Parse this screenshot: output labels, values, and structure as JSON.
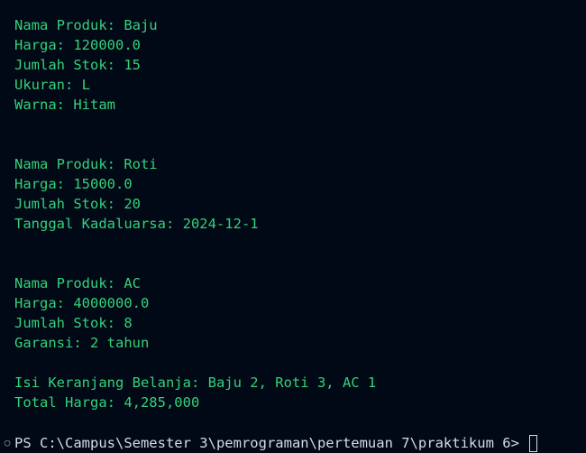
{
  "output": {
    "product1": {
      "name": "Nama Produk: Baju",
      "price": "Harga: 120000.0",
      "stock": "Jumlah Stok: 15",
      "size": "Ukuran: L",
      "color": "Warna: Hitam"
    },
    "product2": {
      "name": "Nama Produk: Roti",
      "price": "Harga: 15000.0",
      "stock": "Jumlah Stok: 20",
      "expiry": "Tanggal Kadaluarsa: 2024-12-1"
    },
    "product3": {
      "name": "Nama Produk: AC",
      "price": "Harga: 4000000.0",
      "stock": "Jumlah Stok: 8",
      "warranty": "Garansi: 2 tahun"
    },
    "cart": {
      "contents": "Isi Keranjang Belanja: Baju 2, Roti 3, AC 1",
      "total": "Total Harga: 4,285,000"
    }
  },
  "prompt": {
    "marker": "○",
    "text": "PS C:\\Campus\\Semester 3\\pemrograman\\pertemuan 7\\praktikum 6> "
  },
  "colors": {
    "background": "#010816",
    "output_text": "#34d27a",
    "prompt_text": "#d6dbe3"
  }
}
